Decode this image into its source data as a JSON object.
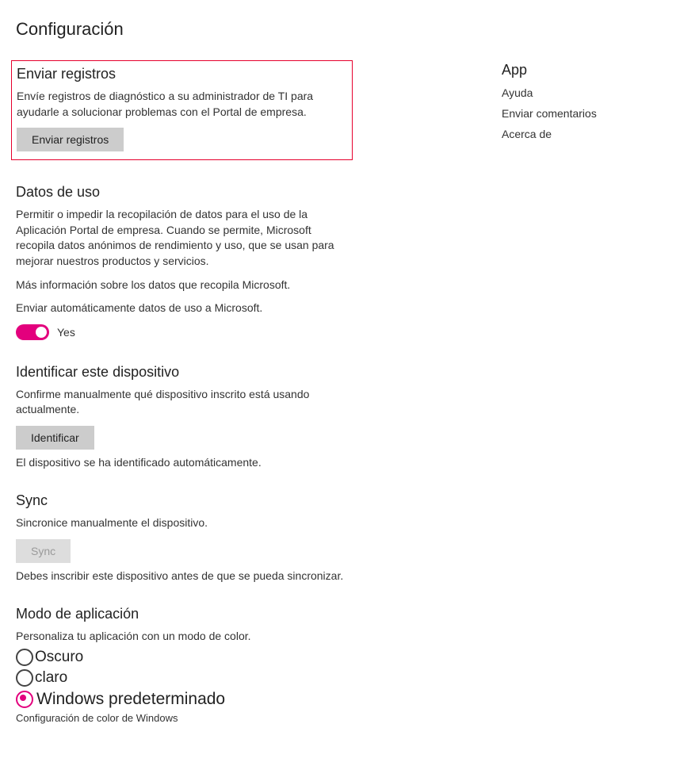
{
  "page_title": "Configuración",
  "send_logs": {
    "title": "Enviar registros",
    "desc": "Envíe registros de diagnóstico a su administrador de TI para ayudarle a solucionar problemas con el Portal de empresa.",
    "button": "Enviar registros"
  },
  "usage_data": {
    "title": "Datos de uso",
    "desc": "Permitir o impedir la recopilación de datos para el uso de la Aplicación Portal de empresa. Cuando se permite, Microsoft recopila datos anónimos de rendimiento y uso, que se usan para mejorar nuestros productos y servicios.",
    "more_info": "Más información sobre los datos que recopila Microsoft.",
    "auto_send": "Enviar automáticamente datos de uso a Microsoft.",
    "toggle_label": "Yes",
    "toggle_on": true,
    "accent_color": "#e3007d"
  },
  "identify": {
    "title": "Identificar este dispositivo",
    "desc": "Confirme manualmente qué dispositivo inscrito está usando actualmente.",
    "button": "Identificar",
    "status": "El dispositivo se ha identificado automáticamente."
  },
  "sync": {
    "title": "Sync",
    "desc": "Sincronice manualmente el dispositivo.",
    "button": "Sync",
    "status": "Debes inscribir este dispositivo antes de que se pueda sincronizar."
  },
  "app_mode": {
    "title": "Modo de aplicación",
    "desc": "Personaliza tu aplicación con un modo de color.",
    "options": [
      "Oscuro",
      "claro",
      "Windows predeterminado"
    ],
    "selected_index": 2,
    "caption": "Configuración de color de Windows"
  },
  "sidebar": {
    "title": "App",
    "links": [
      "Ayuda",
      "Enviar comentarios",
      "Acerca de"
    ]
  }
}
